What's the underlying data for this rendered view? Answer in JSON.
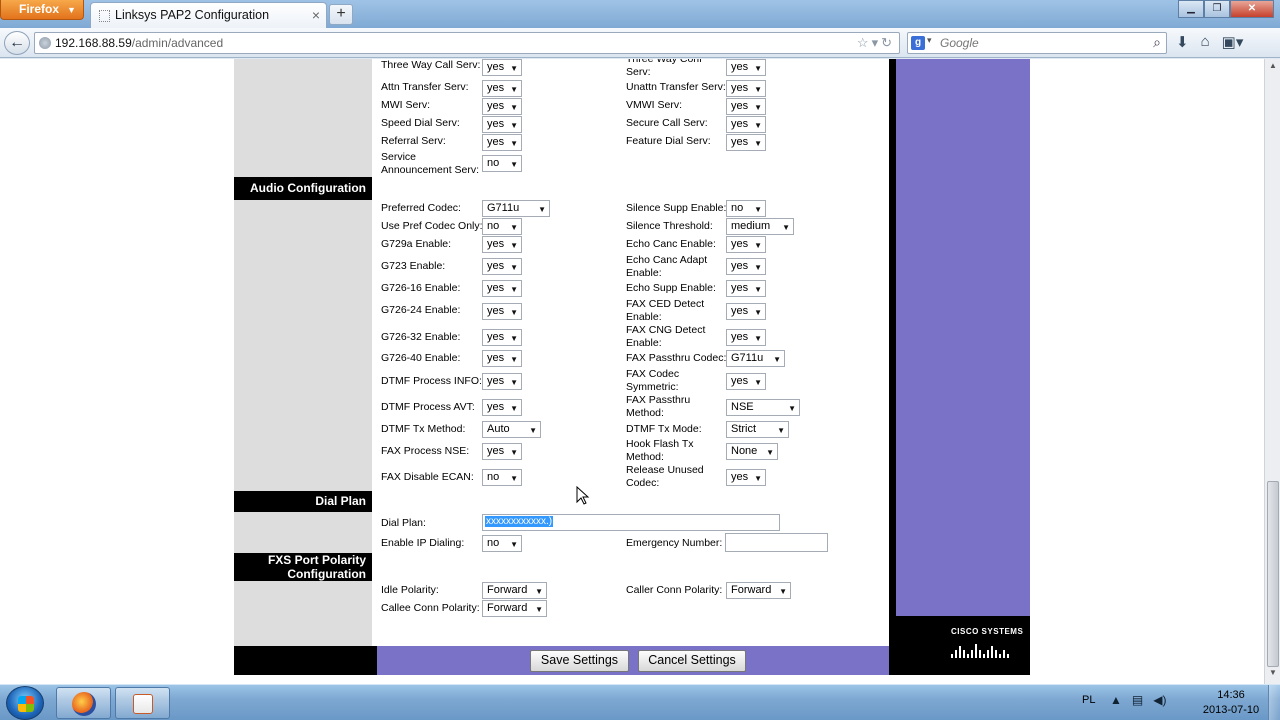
{
  "browser": {
    "firefox_label": "Firefox",
    "tab_title": "Linksys PAP2 Configuration",
    "url_host": "192.168.88.59",
    "url_path": "/admin/advanced",
    "search_placeholder": "Google"
  },
  "sections": {
    "audio": "Audio Configuration",
    "dialplan": "Dial Plan",
    "fxs_line1": "FXS Port Polarity",
    "fxs_line2": "Configuration"
  },
  "fields": {
    "three_way_call_serv": {
      "label": "Three Way Call Serv:",
      "value": "yes"
    },
    "three_way_conf_serv": {
      "label": "Three Way Conf Serv:",
      "value": "yes"
    },
    "attn_transfer_serv": {
      "label": "Attn Transfer Serv:",
      "value": "yes"
    },
    "unattn_transfer_serv": {
      "label": "Unattn Transfer Serv:",
      "value": "yes"
    },
    "mwi_serv": {
      "label": "MWI Serv:",
      "value": "yes"
    },
    "vmwi_serv": {
      "label": "VMWI Serv:",
      "value": "yes"
    },
    "speed_dial_serv": {
      "label": "Speed Dial Serv:",
      "value": "yes"
    },
    "secure_call_serv": {
      "label": "Secure Call Serv:",
      "value": "yes"
    },
    "referral_serv": {
      "label": "Referral Serv:",
      "value": "yes"
    },
    "feature_dial_serv": {
      "label": "Feature Dial Serv:",
      "value": "yes"
    },
    "service_announcement_serv": {
      "label1": "Service",
      "label2": "Announcement Serv:",
      "value": "no"
    },
    "preferred_codec": {
      "label": "Preferred Codec:",
      "value": "G711u"
    },
    "silence_supp_enable": {
      "label": "Silence Supp Enable:",
      "value": "no"
    },
    "use_pref_codec_only": {
      "label": "Use Pref Codec Only:",
      "value": "no"
    },
    "silence_threshold": {
      "label": "Silence Threshold:",
      "value": "medium"
    },
    "g729a_enable": {
      "label": "G729a Enable:",
      "value": "yes"
    },
    "echo_canc_enable": {
      "label": "Echo Canc Enable:",
      "value": "yes"
    },
    "g723_enable": {
      "label": "G723 Enable:",
      "value": "yes"
    },
    "echo_canc_adapt_enable": {
      "label1": "Echo Canc Adapt",
      "label2": "Enable:",
      "value": "yes"
    },
    "g726_16_enable": {
      "label": "G726-16 Enable:",
      "value": "yes"
    },
    "echo_supp_enable": {
      "label": "Echo Supp Enable:",
      "value": "yes"
    },
    "g726_24_enable": {
      "label": "G726-24 Enable:",
      "value": "yes"
    },
    "fax_ced_detect_enable": {
      "label1": "FAX CED Detect",
      "label2": "Enable:",
      "value": "yes"
    },
    "g726_32_enable": {
      "label": "G726-32 Enable:",
      "value": "yes"
    },
    "fax_cng_detect_enable": {
      "label1": "FAX CNG Detect",
      "label2": "Enable:",
      "value": "yes"
    },
    "g726_40_enable": {
      "label": "G726-40 Enable:",
      "value": "yes"
    },
    "fax_passthru_codec": {
      "label": "FAX Passthru Codec:",
      "value": "G711u"
    },
    "dtmf_process_info": {
      "label": "DTMF Process INFO:",
      "value": "yes"
    },
    "fax_codec_symmetric": {
      "label1": "FAX Codec",
      "label2": "Symmetric:",
      "value": "yes"
    },
    "dtmf_process_avt": {
      "label": "DTMF Process AVT:",
      "value": "yes"
    },
    "fax_passthru_method": {
      "label1": "FAX Passthru",
      "label2": "Method:",
      "value": "NSE"
    },
    "dtmf_tx_method": {
      "label": "DTMF Tx Method:",
      "value": "Auto"
    },
    "dtmf_tx_mode": {
      "label": "DTMF Tx Mode:",
      "value": "Strict"
    },
    "fax_process_nse": {
      "label": "FAX Process NSE:",
      "value": "yes"
    },
    "hook_flash_tx_method": {
      "label1": "Hook Flash Tx",
      "label2": "Method:",
      "value": "None"
    },
    "fax_disable_ecan": {
      "label": "FAX Disable ECAN:",
      "value": "no"
    },
    "release_unused_codec": {
      "label1": "Release Unused",
      "label2": "Codec:",
      "value": "yes"
    },
    "dial_plan": {
      "label": "Dial Plan:",
      "value": "xxxxxxxxxxxx.)"
    },
    "enable_ip_dialing": {
      "label": "Enable IP Dialing:",
      "value": "no"
    },
    "emergency_number": {
      "label": "Emergency Number:",
      "value": ""
    },
    "idle_polarity": {
      "label": "Idle Polarity:",
      "value": "Forward"
    },
    "caller_conn_polarity": {
      "label": "Caller Conn Polarity:",
      "value": "Forward"
    },
    "callee_conn_polarity": {
      "label": "Callee Conn Polarity:",
      "value": "Forward"
    }
  },
  "buttons": {
    "save": "Save Settings",
    "cancel": "Cancel Settings"
  },
  "brand": "CISCO SYSTEMS",
  "taskbar": {
    "lang": "PL",
    "time": "14:36",
    "date": "2013-07-10"
  }
}
